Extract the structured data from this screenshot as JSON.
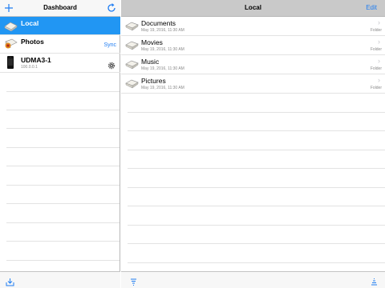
{
  "left": {
    "title": "Dashboard",
    "items": [
      {
        "name": "Local",
        "subtitle": "",
        "action": "",
        "selected": true
      },
      {
        "name": "Photos",
        "subtitle": "",
        "action": "Sync",
        "selected": false
      },
      {
        "name": "UDMA3-1",
        "subtitle": "100.0.0.1",
        "action": "",
        "selected": false
      }
    ]
  },
  "right": {
    "title": "Local",
    "edit_label": "Edit",
    "files": [
      {
        "name": "Documents",
        "date": "May 19, 2016, 11:30 AM",
        "type": "Folder"
      },
      {
        "name": "Movies",
        "date": "May 19, 2016, 11:30 AM",
        "type": "Folder"
      },
      {
        "name": "Music",
        "date": "May 19, 2016, 11:30 AM",
        "type": "Folder"
      },
      {
        "name": "Pictures",
        "date": "May 19, 2016, 11:30 AM",
        "type": "Folder"
      }
    ]
  },
  "colors": {
    "accent": "#1f7df2",
    "selected_row": "#2196f3",
    "right_header": "#c9c9c9"
  },
  "icons": {
    "add": "plus-icon",
    "refresh": "refresh-icon",
    "settings": "gear-icon",
    "download": "download-tray-icon",
    "sort_left": "sort-lines-icon",
    "sort_right": "sort-lines-icon"
  }
}
